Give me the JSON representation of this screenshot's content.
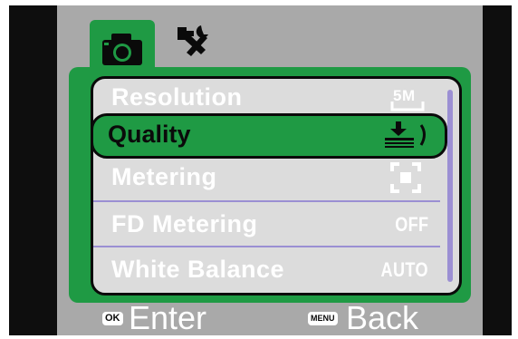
{
  "menu": {
    "items": [
      {
        "label": "Resolution",
        "value": "5M",
        "icon": "resolution-5m-icon"
      },
      {
        "label": "Quality",
        "value": "",
        "icon": "quality-stars-icon"
      },
      {
        "label": "Metering",
        "value": "",
        "icon": "spot-metering-icon"
      },
      {
        "label": "FD Metering",
        "value": "OFF"
      },
      {
        "label": "White Balance",
        "value": "AUTO"
      }
    ],
    "selected_index": 1
  },
  "tabs": [
    {
      "name": "camera-tab",
      "icon": "camera-icon"
    },
    {
      "name": "settings-tab",
      "icon": "wrench-hammer-icon"
    }
  ],
  "footer": {
    "ok_key": "OK",
    "ok_label": "Enter",
    "menu_key": "MENU",
    "menu_label": "Back"
  },
  "colors": {
    "accent_green": "#1f9a44",
    "panel_gray": "#a9a9a9",
    "list_bg": "#dcdcdc",
    "divider_purple": "#9b8fd3"
  }
}
